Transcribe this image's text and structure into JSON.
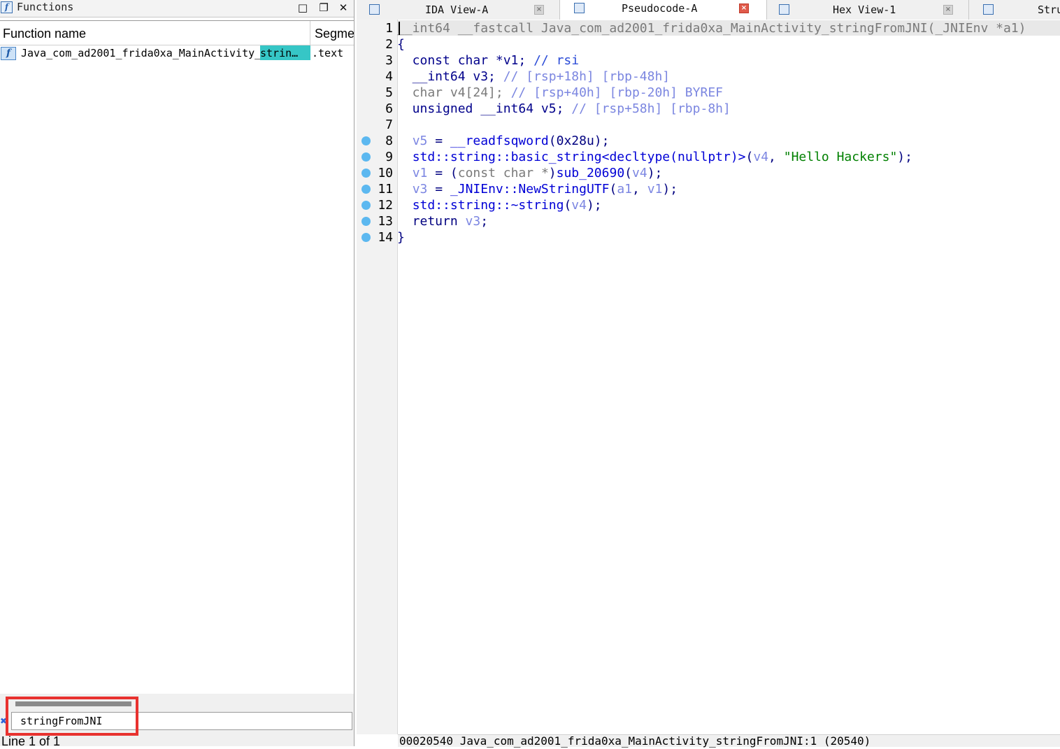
{
  "functions_panel": {
    "title": "Functions",
    "col_function_name": "Function name",
    "col_segment": "Segme",
    "row": {
      "name_prefix": "Java_com_ad2001_frida0xa_MainActivity_",
      "name_highlight": "strin…",
      "segment": ".text"
    },
    "search": {
      "value": "stringFromJNI"
    },
    "status": "Line 1 of 1",
    "icons": [
      "function-icon",
      "maximize-icon",
      "restore-icon",
      "close-icon"
    ]
  },
  "tabs": [
    {
      "label": "IDA View-A",
      "icon": "ida-view-icon",
      "active": false
    },
    {
      "label": "Pseudocode-A",
      "icon": "pseudocode-icon",
      "active": true
    },
    {
      "label": "Hex View-1",
      "icon": "hex-view-icon",
      "active": false
    },
    {
      "label": "Stru",
      "icon": "structures-icon",
      "active": false
    }
  ],
  "code": {
    "line_numbers": [
      "1",
      "2",
      "3",
      "4",
      "5",
      "6",
      "7",
      "8",
      "9",
      "10",
      "11",
      "12",
      "13",
      "14"
    ],
    "line1": {
      "t1": "__int64 __fastcall Java_com_ad2001_frida0xa_MainActivity_stringFromJNI(_JNIEnv *a1)"
    },
    "line2": {
      "t1": "{"
    },
    "line3": {
      "t1": "  const char *v1; ",
      "t2": "// rsi"
    },
    "line4": {
      "t1": "  __int64 v3; ",
      "t2": "// [rsp+18h] [rbp-48h]"
    },
    "line5": {
      "t1": "  char v4[24]; ",
      "t2": "// [rsp+40h] [rbp-20h] BYREF"
    },
    "line6": {
      "t1": "  unsigned __int64 v5; ",
      "t2": "// [rsp+58h] [rbp-8h]"
    },
    "line8": {
      "a": "  ",
      "v": "v5",
      "b": " = ",
      "f": "__readfsqword",
      "c": "(0x28u);"
    },
    "line9": {
      "a": "  ",
      "f": "std::string::basic_string<decltype(nullptr)>",
      "b": "(",
      "v": "v4",
      "c": ", ",
      "s": "\"Hello Hackers\"",
      "d": ");"
    },
    "line10": {
      "a": "  ",
      "v": "v1",
      "b": " = (",
      "g": "const char *",
      "c": ")",
      "f": "sub_20690",
      "d": "(",
      "v2": "v4",
      "e": ");"
    },
    "line11": {
      "a": "  ",
      "v": "v3",
      "b": " = ",
      "f": "_JNIEnv::NewStringUTF",
      "c": "(",
      "v2": "a1",
      "d": ", ",
      "v3": "v1",
      "e": ");"
    },
    "line12": {
      "a": "  ",
      "f": "std::string::~string",
      "b": "(",
      "v": "v4",
      "c": ");"
    },
    "line13": {
      "a": "  return ",
      "v": "v3",
      "b": ";"
    },
    "line14": {
      "t1": "}"
    }
  },
  "status_bar": "00020540 Java_com_ad2001_frida0xa_MainActivity_stringFromJNI:1 (20540)",
  "colors": {
    "highlight": "#36c6c6",
    "breakpoint": "#5cb8f0",
    "annotation": "#e8322f"
  }
}
